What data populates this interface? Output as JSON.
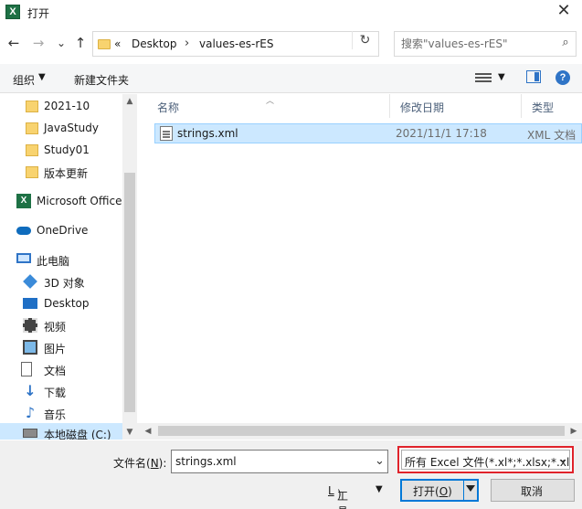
{
  "window": {
    "title": "打开",
    "app_icon": "excel-icon",
    "close_glyph": "✕"
  },
  "nav": {
    "back": "←",
    "forward": "→",
    "recent": "⌄",
    "up": "↑"
  },
  "address": {
    "prefix": "«",
    "crumbs": [
      "Desktop",
      "values-es-rES"
    ],
    "separator": "›",
    "refresh": "↻"
  },
  "search": {
    "placeholder": "搜索\"values-es-rES\"",
    "icon": "⌕"
  },
  "toolbar": {
    "organize": "组织",
    "new_folder": "新建文件夹",
    "caret": "▼",
    "help": "?"
  },
  "sidebar": {
    "items": [
      {
        "label": "2021-10",
        "icon": "folder-icon"
      },
      {
        "label": "JavaStudy",
        "icon": "folder-icon"
      },
      {
        "label": "Study01",
        "icon": "folder-icon"
      },
      {
        "label": "版本更新",
        "icon": "folder-icon"
      },
      {
        "label": "Microsoft Office",
        "icon": "excel-icon"
      },
      {
        "label": "OneDrive",
        "icon": "cloud-icon"
      },
      {
        "label": "此电脑",
        "icon": "computer-icon"
      },
      {
        "label": "3D 对象",
        "icon": "3d-objects-icon"
      },
      {
        "label": "Desktop",
        "icon": "desktop-icon"
      },
      {
        "label": "视频",
        "icon": "video-icon"
      },
      {
        "label": "图片",
        "icon": "pictures-icon"
      },
      {
        "label": "文档",
        "icon": "documents-icon"
      },
      {
        "label": "下载",
        "icon": "download-icon"
      },
      {
        "label": "音乐",
        "icon": "music-icon"
      },
      {
        "label": "本地磁盘 (C:)",
        "icon": "drive-icon",
        "selected": true
      }
    ]
  },
  "columns": {
    "name": "名称",
    "modified": "修改日期",
    "type": "类型"
  },
  "files": [
    {
      "name": "strings.xml",
      "modified": "2021/11/1 17:18",
      "type": "XML 文档"
    }
  ],
  "footer": {
    "filename_label_pre": "文件名(",
    "filename_label_key": "N",
    "filename_label_post": "):",
    "filename_value": "strings.xml",
    "filter_value": "所有 Excel 文件(*.xl*;*.xlsx;*.xl",
    "tools_pre": "工具(",
    "tools_key": "L",
    "tools_post": ")",
    "open_pre": "打开(",
    "open_key": "O",
    "open_post": ")",
    "cancel": "取消"
  }
}
